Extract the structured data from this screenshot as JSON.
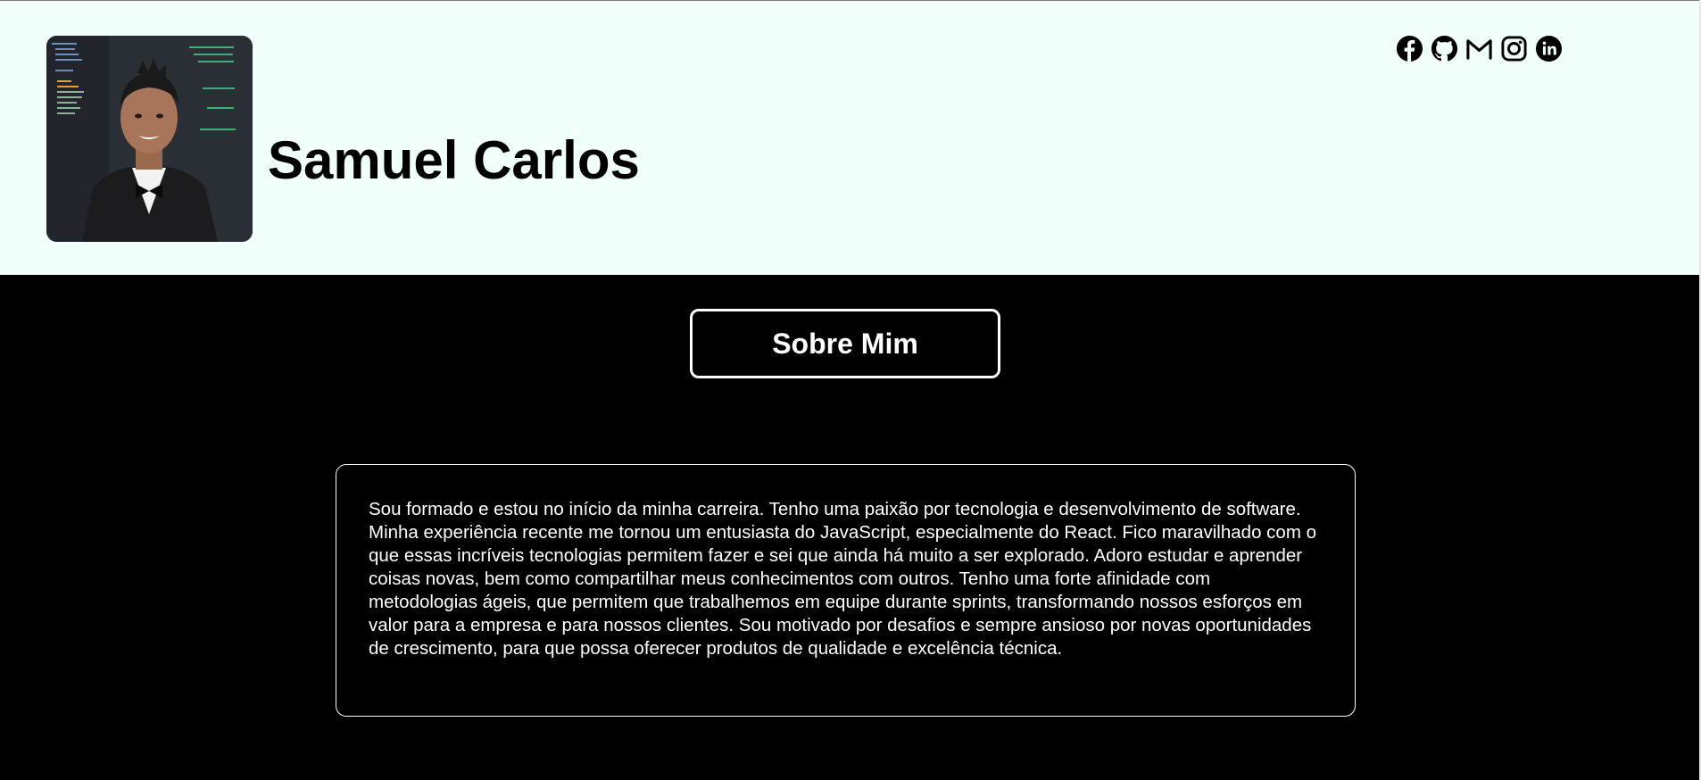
{
  "profile": {
    "name": "Samuel Carlos",
    "avatar_alt": "Samuel Carlos"
  },
  "socials": [
    {
      "icon": "facebook-icon",
      "label": "Facebook"
    },
    {
      "icon": "github-icon",
      "label": "GitHub"
    },
    {
      "icon": "gmail-icon",
      "label": "Gmail"
    },
    {
      "icon": "instagram-icon",
      "label": "Instagram"
    },
    {
      "icon": "linkedin-icon",
      "label": "LinkedIn"
    }
  ],
  "about": {
    "button_label": "Sobre Mim",
    "text": "Sou formado e estou no início da minha carreira. Tenho uma paixão por tecnologia e desenvolvimento de software. Minha experiência recente me tornou um entusiasta do JavaScript, especialmente do React. Fico maravilhado com o que essas incríveis tecnologias permitem fazer e sei que ainda há muito a ser explorado. Adoro estudar e aprender coisas novas, bem como compartilhar meus conhecimentos com outros. Tenho uma forte afinidade com metodologias ágeis, que permitem que trabalhemos em equipe durante sprints, transformando nossos esforços em valor para a empresa e para nossos clientes. Sou motivado por desafios e sempre ansioso por novas oportunidades de crescimento, para que possa oferecer produtos de qualidade e excelência técnica."
  },
  "colors": {
    "header_bg": "#f0fff9",
    "page_bg": "#000000",
    "text_light": "#ffffff",
    "text_dark": "#000000"
  }
}
